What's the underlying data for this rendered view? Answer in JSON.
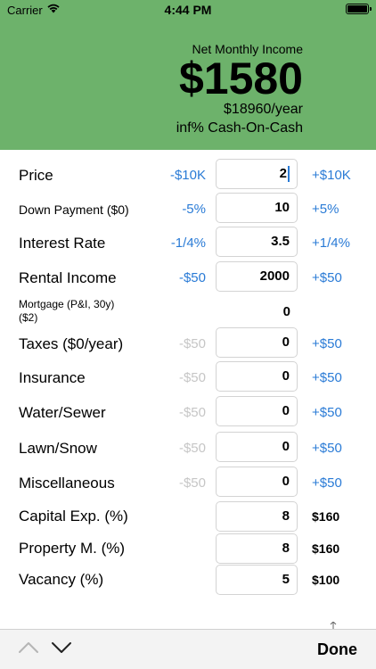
{
  "status": {
    "carrier": "Carrier",
    "time": "4:44 PM"
  },
  "summary": {
    "net_label": "Net Monthly Income",
    "net_value": "$1580",
    "year_value": "$18960/year",
    "coc_value": "inf% Cash-On-Cash",
    "accent_color": "#6db26b"
  },
  "rows": {
    "price": {
      "label": "Price",
      "minus": "-$10K",
      "value": "2",
      "plus": "+$10K"
    },
    "down_payment": {
      "label": "Down Payment ($0)",
      "minus": "-5%",
      "value": "10",
      "plus": "+5%"
    },
    "interest_rate": {
      "label": "Interest Rate",
      "minus": "-1/4%",
      "value": "3.5",
      "plus": "+1/4%"
    },
    "rental_income": {
      "label": "Rental Income",
      "minus": "-$50",
      "value": "2000",
      "plus": "+$50"
    },
    "mortgage": {
      "label_line1": "Mortgage (P&I, 30y)",
      "label_line2": "($2)",
      "value": "0"
    },
    "taxes": {
      "label": "Taxes ($0/year)",
      "minus": "-$50",
      "value": "0",
      "plus": "+$50"
    },
    "insurance": {
      "label": "Insurance",
      "minus": "-$50",
      "value": "0",
      "plus": "+$50"
    },
    "water_sewer": {
      "label": "Water/Sewer",
      "minus": "-$50",
      "value": "0",
      "plus": "+$50"
    },
    "lawn_snow": {
      "label": "Lawn/Snow",
      "minus": "-$50",
      "value": "0",
      "plus": "+$50"
    },
    "miscellaneous": {
      "label": "Miscellaneous",
      "minus": "-$50",
      "value": "0",
      "plus": "+$50"
    },
    "capital_exp": {
      "label": "Capital Exp. (%)",
      "value": "8",
      "amount": "$160"
    },
    "property_m": {
      "label": "Property M. (%)",
      "value": "8",
      "amount": "$160"
    },
    "vacancy": {
      "label": "Vacancy (%)",
      "value": "5",
      "amount": "$100"
    }
  },
  "toolbar": {
    "done_label": "Done"
  },
  "icons": {
    "wifi": "wifi-icon",
    "battery": "battery-icon",
    "up": "chevron-up-icon",
    "down": "chevron-down-icon"
  }
}
